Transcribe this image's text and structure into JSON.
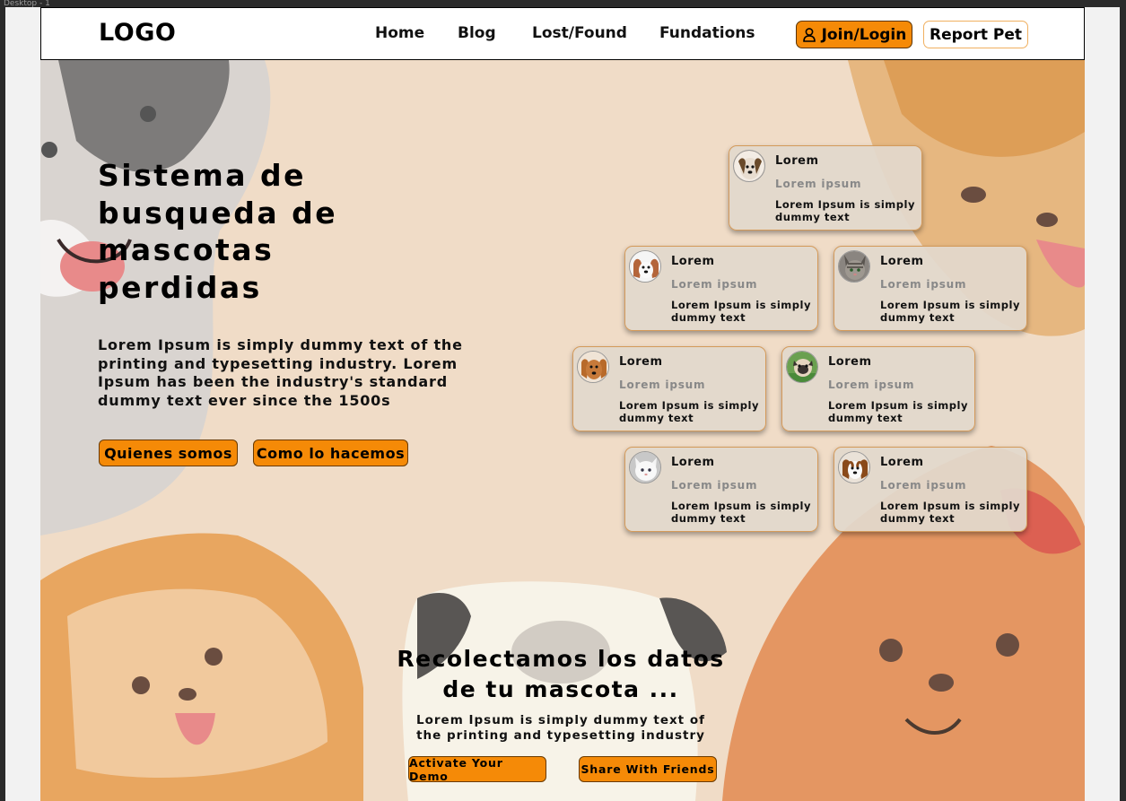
{
  "window": {
    "strip_label": "Desktop - 1"
  },
  "navbar": {
    "logo": "LOGO",
    "links": [
      "Home",
      "Blog",
      "Lost/Found",
      "Fundations"
    ],
    "join_label": "Join/Login",
    "report_label": "Report Pet"
  },
  "hero": {
    "title": "Sistema de busqueda de mascotas perdidas",
    "text": "Lorem Ipsum is simply dummy text of the printing and typesetting industry. Lorem Ipsum has been the industry's standard dummy text ever since the 1500s",
    "btn_about": "Quienes somos",
    "btn_how": "Como lo hacemos"
  },
  "cards": [
    {
      "title": "Lorem",
      "subtitle": "Lorem ipsum",
      "desc": "Lorem Ipsum is simply dummy text",
      "pet": "dog-beagle"
    },
    {
      "title": "Lorem",
      "subtitle": "Lorem ipsum",
      "desc": "Lorem Ipsum is simply dummy text",
      "pet": "dog-cavalier"
    },
    {
      "title": "Lorem",
      "subtitle": "Lorem ipsum",
      "desc": "Lorem Ipsum is simply dummy text",
      "pet": "cat-tabby"
    },
    {
      "title": "Lorem",
      "subtitle": "Lorem ipsum",
      "desc": "Lorem Ipsum is simply dummy text",
      "pet": "dog-golden"
    },
    {
      "title": "Lorem",
      "subtitle": "Lorem ipsum",
      "desc": "Lorem Ipsum is simply dummy text",
      "pet": "dog-pug"
    },
    {
      "title": "Lorem",
      "subtitle": "Lorem ipsum",
      "desc": "Lorem Ipsum is simply dummy text",
      "pet": "cat-white"
    },
    {
      "title": "Lorem",
      "subtitle": "Lorem ipsum",
      "desc": "Lorem Ipsum is simply dummy text",
      "pet": "dog-spaniel"
    }
  ],
  "bottom": {
    "title": "Recolectamos los datos de tu mascota ...",
    "text": "Lorem Ipsum is simply dummy text of the printing and typesetting industry",
    "btn_demo": "Activate Your Demo",
    "btn_share": "Share With Friends"
  },
  "colors": {
    "accent": "#f58a07",
    "background": "#f0dcc7",
    "card": "#e2d8cc"
  }
}
